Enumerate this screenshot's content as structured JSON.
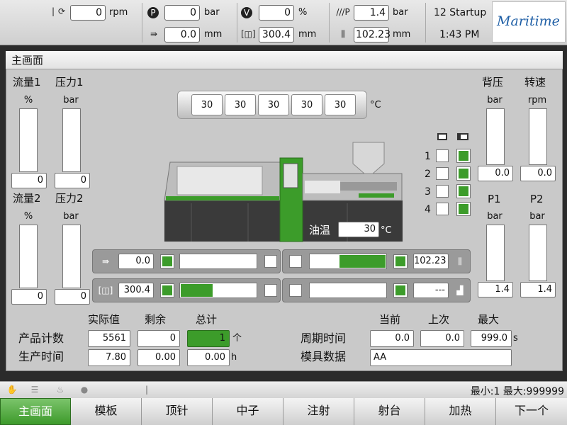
{
  "topbar": {
    "rpm_value": "0",
    "rpm_unit": "rpm",
    "pressure1_value": "0",
    "pressure1_unit": "bar",
    "pos1_value": "0.0",
    "pos1_unit": "mm",
    "velocity_value": "0",
    "velocity_unit": "%",
    "pos2_value": "300.4",
    "pos2_unit": "mm",
    "pp_value": "1.4",
    "pp_unit": "bar",
    "pos3_value": "102.23",
    "pos3_unit": "mm",
    "mode_label": "12 Startup",
    "time": "1:43 PM",
    "logo": "Maritime"
  },
  "main": {
    "title": "主画面",
    "flow1_label": "流量1",
    "pressure1_label": "压力1",
    "flow2_label": "流量2",
    "pressure2_label": "压力2",
    "back_pressure_label": "背压",
    "speed_label": "转速",
    "p1_label": "P1",
    "p2_label": "P2",
    "unit_percent": "%",
    "unit_bar": "bar",
    "unit_rpm": "rpm",
    "flow1_value": "0",
    "pressure1_value": "0",
    "flow2_value": "0",
    "pressure2_value": "0",
    "back_pressure_value": "0.0",
    "speed_value": "0.0",
    "p1_value": "1.4",
    "p2_value": "1.4",
    "zones": [
      "30",
      "30",
      "30",
      "30",
      "30"
    ],
    "zone_unit": "°C",
    "channel_numbers": [
      "1",
      "2",
      "3",
      "4"
    ],
    "oil_temp_label": "油温",
    "oil_temp_value": "30",
    "oil_temp_unit": "°C",
    "row1_left_value": "0.0",
    "row1_right_value": "102.23",
    "row2_left_value": "300.4",
    "row2_right_value": "---",
    "row1_right_fill": 0.6,
    "row2_left_fill": 0.42
  },
  "stats": {
    "actual_label": "实际值",
    "remain_label": "剩余",
    "total_label": "总计",
    "count_label": "产品计数",
    "count_actual": "5561",
    "count_remain": "0",
    "count_total": "1",
    "count_unit": "个",
    "time_label": "生产时间",
    "time_actual": "7.80",
    "time_remain": "0.00",
    "time_total": "0.00",
    "time_unit": "h",
    "current_label": "当前",
    "last_label": "上次",
    "max_label": "最大",
    "cycle_label": "周期时间",
    "cycle_current": "0.0",
    "cycle_last": "0.0",
    "cycle_max": "999.0",
    "cycle_unit": "s",
    "mold_label": "模具数据",
    "mold_value": "AA"
  },
  "status": {
    "range_text": "最小:1 最大:999999"
  },
  "nav": [
    "主画面",
    "模板",
    "顶针",
    "中子",
    "注射",
    "射台",
    "加热",
    "下一个"
  ],
  "colors": {
    "accent": "#3c9c2a",
    "background": "#c9c9c9"
  }
}
